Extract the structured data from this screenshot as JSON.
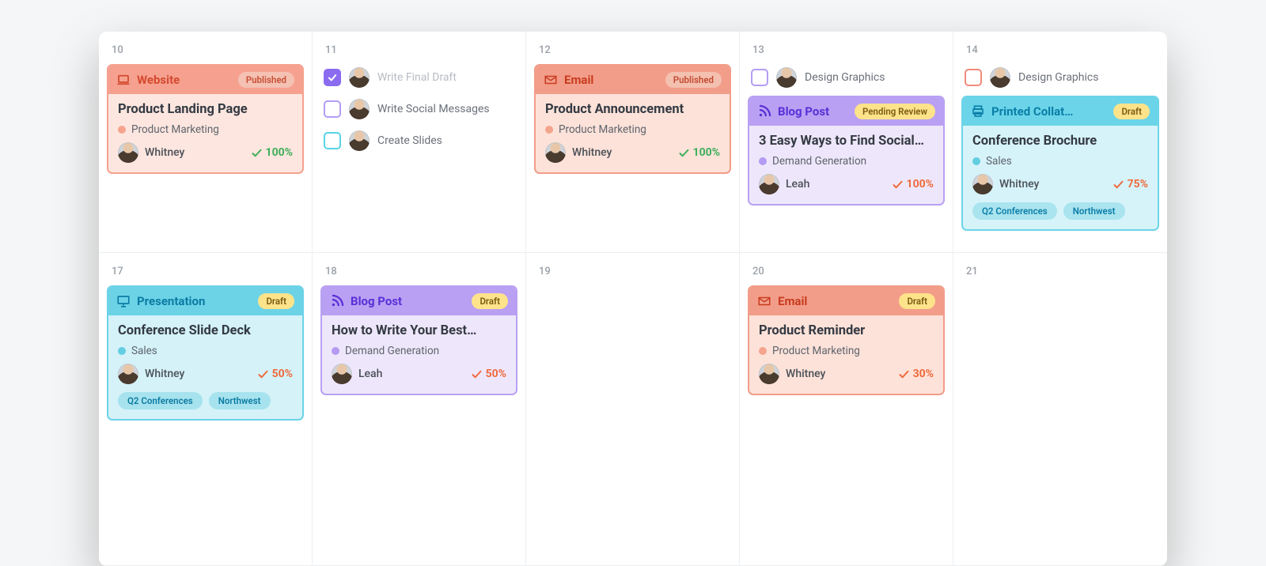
{
  "week1": [
    "10",
    "11",
    "12",
    "13",
    "14"
  ],
  "week2": [
    "17",
    "18",
    "19",
    "20",
    "21"
  ],
  "tasks": {
    "c11": [
      {
        "label": "Write Final Draft",
        "done": true,
        "chk": "purple-filled"
      },
      {
        "label": "Write Social Messages",
        "done": false,
        "chk": "purple-outline"
      },
      {
        "label": "Create Slides",
        "done": false,
        "chk": "cyan-outline"
      }
    ],
    "c13": [
      {
        "label": "Design Graphics",
        "done": false,
        "chk": "purple-outline"
      }
    ],
    "c14": [
      {
        "label": "Design Graphics",
        "done": false,
        "chk": "red-outline"
      }
    ]
  },
  "cards": {
    "c10": {
      "type": "Website",
      "status": "Published",
      "title": "Product Landing Page",
      "category": "Product Marketing",
      "owner": "Whitney",
      "progress": "100%"
    },
    "c12": {
      "type": "Email",
      "status": "Published",
      "title": "Product Announcement",
      "category": "Product Marketing",
      "owner": "Whitney",
      "progress": "100%"
    },
    "c13": {
      "type": "Blog Post",
      "status": "Pending Review",
      "title": "3 Easy Ways to Find Social…",
      "category": "Demand Generation",
      "owner": "Leah",
      "progress": "100%"
    },
    "c14": {
      "type": "Printed Collat…",
      "status": "Draft",
      "title": "Conference Brochure",
      "category": "Sales",
      "owner": "Whitney",
      "progress": "75%",
      "tags": [
        "Q2 Conferences",
        "Northwest"
      ]
    },
    "c17": {
      "type": "Presentation",
      "status": "Draft",
      "title": "Conference Slide Deck",
      "category": "Sales",
      "owner": "Whitney",
      "progress": "50%",
      "tags": [
        "Q2 Conferences",
        "Northwest"
      ]
    },
    "c18": {
      "type": "Blog Post",
      "status": "Draft",
      "title": "How to Write Your Best…",
      "category": "Demand Generation",
      "owner": "Leah",
      "progress": "50%"
    },
    "c20": {
      "type": "Email",
      "status": "Draft",
      "title": "Product Reminder",
      "category": "Product Marketing",
      "owner": "Whitney",
      "progress": "30%"
    }
  }
}
